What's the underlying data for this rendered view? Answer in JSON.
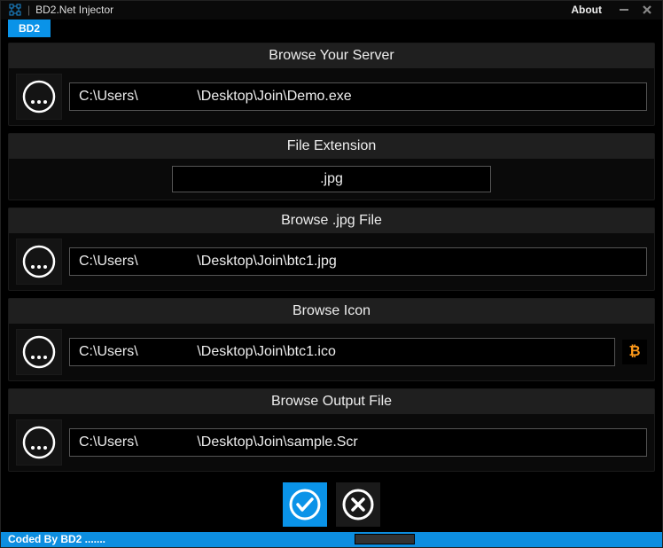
{
  "titlebar": {
    "title": "BD2.Net Injector",
    "about": "About"
  },
  "tabs": {
    "main": "BD2"
  },
  "sections": {
    "server": {
      "header": "Browse Your Server",
      "path": "C:\\Users\\               \\Desktop\\Join\\Demo.exe"
    },
    "extension": {
      "header": "File Extension",
      "value": ".jpg"
    },
    "jpg": {
      "header": "Browse .jpg File",
      "path": "C:\\Users\\               \\Desktop\\Join\\btc1.jpg"
    },
    "icon": {
      "header": "Browse Icon",
      "path": "C:\\Users\\               \\Desktop\\Join\\btc1.ico",
      "preview": "₿"
    },
    "output": {
      "header": "Browse Output File",
      "path": "C:\\Users\\               \\Desktop\\Join\\sample.Scr"
    }
  },
  "status": {
    "text": "Coded By BD2 ......."
  }
}
